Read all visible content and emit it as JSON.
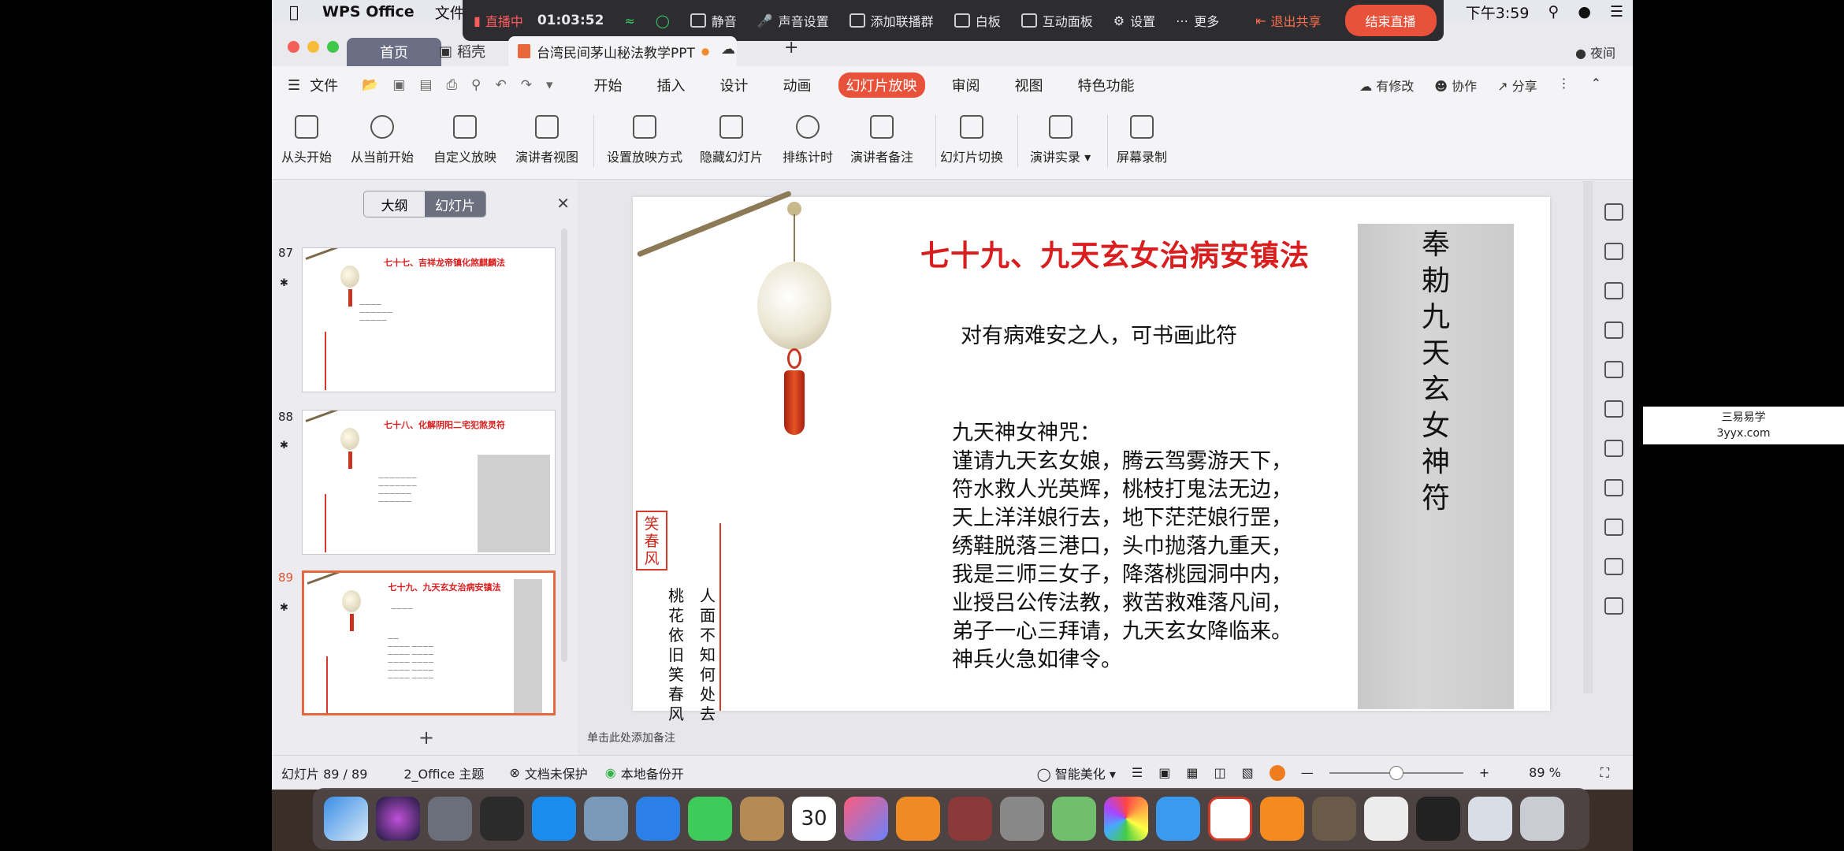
{
  "menubar": {
    "app": "WPS Office",
    "menu1": "文件",
    "clock": "下午3:59"
  },
  "livebar": {
    "live": "直播中",
    "timer": "01:03:52",
    "items": [
      "静音",
      "声音设置",
      "添加联播群",
      "白板",
      "互动面板",
      "设置",
      "更多"
    ],
    "exit": "退出共享",
    "end": "结束直播"
  },
  "tabs": {
    "home": "首页",
    "template": "稻壳",
    "doc": "台湾民间茅山秘法教学PPT",
    "night": "夜间"
  },
  "menu": {
    "file": "文件",
    "items": [
      "开始",
      "插入",
      "设计",
      "动画",
      "幻灯片放映",
      "审阅",
      "视图",
      "特色功能"
    ],
    "selected_index": 4,
    "right": [
      "有修改",
      "协作",
      "分享"
    ]
  },
  "ribbon": [
    "从头开始",
    "从当前开始",
    "自定义放映",
    "演讲者视图",
    "设置放映方式",
    "隐藏幻灯片",
    "排练计时",
    "演讲者备注",
    "幻灯片切换",
    "演讲实录",
    "屏幕录制"
  ],
  "panel": {
    "seg": [
      "大纲",
      "幻灯片"
    ],
    "thumbs": [
      {
        "num": "87",
        "title": "七十七、吉祥龙帝镇化煞麒麟法"
      },
      {
        "num": "88",
        "title": "七十八、化解阴阳二宅犯煞灵符"
      },
      {
        "num": "89",
        "title": "七十九、九天玄女治病安镇法"
      }
    ]
  },
  "slide": {
    "title": "七十九、九天玄女治病安镇法",
    "subtitle": "对有病难安之人，可书画此符",
    "poem": [
      "九天神女神咒：",
      "谨请九天玄女娘，腾云驾雾游天下，",
      "符水救人光英辉，桃枝打鬼法无边，",
      "天上洋洋娘行去，地下茫茫娘行罡，",
      "绣鞋脱落三港口，头巾抛落九重天，",
      "我是三师三女子，降落桃园洞中内，",
      "业授吕公传法教，救苦救难落凡间，",
      "弟子一心三拜请，九天玄女降临来。",
      "神兵火急如律令。"
    ],
    "talisman": "奉勅九天玄女神符",
    "box_text": "笑春风",
    "vcol1": "人面不知何处去",
    "vcol2": "桃花依旧笑春风"
  },
  "notes": "单击此处添加备注",
  "status": {
    "slide": "幻灯片 89 / 89",
    "theme": "2_Office 主题",
    "protect": "文档未保护",
    "backup": "本地备份开",
    "beautify": "智能美化",
    "zoom": "89 %"
  },
  "dock_calendar": "30",
  "watermark": {
    "line1": "三易易学",
    "line2": "3yyx.com"
  }
}
